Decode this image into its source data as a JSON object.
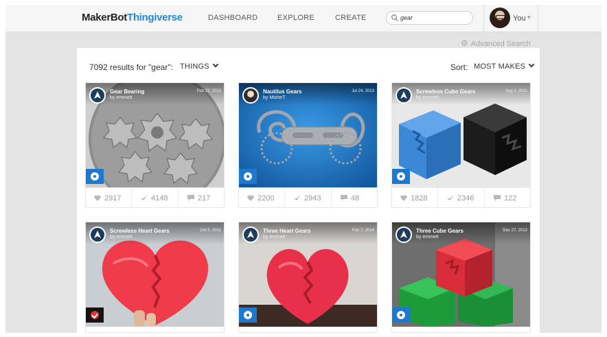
{
  "nav": {
    "logo_makerbot": "MakerBot",
    "logo_thingiverse": "Thingiverse",
    "links": [
      "DASHBOARD",
      "EXPLORE",
      "CREATE"
    ],
    "search_value": "gear",
    "user_label": "You",
    "user_caret": "▾"
  },
  "advanced_search": "Advanced Search",
  "results": {
    "count_text": "7092 results for \"gear\":",
    "filter": "THINGS",
    "sort_label": "Sort:",
    "sort_value": "MOST MAKES"
  },
  "cards": [
    {
      "title": "Gear Bearing",
      "author": "by emmett",
      "date": "Feb 23, 2013",
      "likes": "2917",
      "collects": "4148",
      "comments": "217",
      "badge": "featured"
    },
    {
      "title": "Nautilus Gears",
      "author": "by MisheT",
      "date": "Jul 24, 2013",
      "likes": "2200",
      "collects": "2943",
      "comments": "48",
      "badge": "featured"
    },
    {
      "title": "Screwless Cube Gears",
      "author": "by emmett",
      "date": "Aug 1, 2011",
      "likes": "1828",
      "collects": "2346",
      "comments": "122",
      "badge": "featured"
    },
    {
      "title": "Screwless Heart Gears",
      "author": "by emmett",
      "date": "Oct 5, 2011",
      "badge": "made"
    },
    {
      "title": "Three Heart Gears",
      "author": "by emmett",
      "date": "Feb 7, 2014",
      "badge": "featured"
    },
    {
      "title": "Three Cube Gears",
      "author": "by emmett",
      "date": "Dec 27, 2013",
      "badge": "featured"
    }
  ],
  "colors": {
    "brand_blue": "#1d8ad8",
    "badge_blue": "#1d79d0",
    "badge_red": "#e23131"
  },
  "icons": [
    "search-icon",
    "gear-icon",
    "heart-icon",
    "collect-icon",
    "comment-icon",
    "featured-star-icon",
    "made-check-icon"
  ]
}
